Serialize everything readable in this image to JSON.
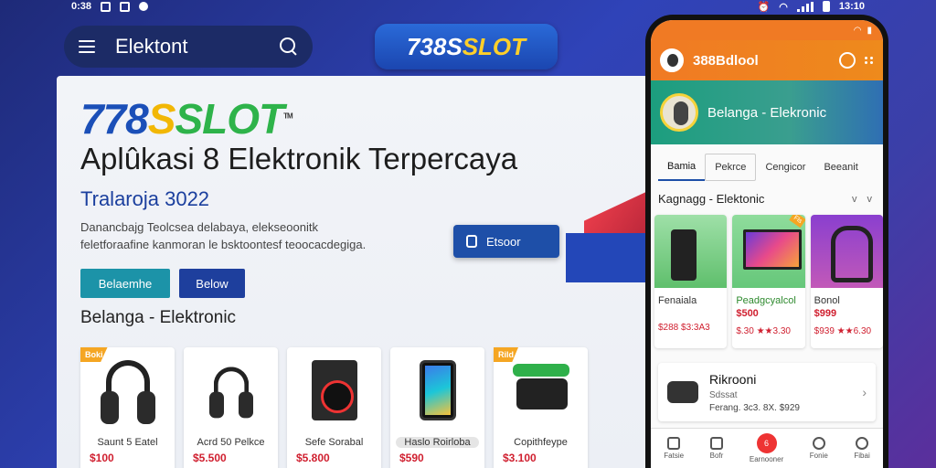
{
  "status_bar": {
    "time_left": "0:38",
    "time_right": "13:10"
  },
  "top_search": {
    "label": "Elektont"
  },
  "brand_pill": {
    "prefix": "738S",
    "highlight": "SLOT"
  },
  "main": {
    "logo": {
      "part1": "778",
      "part2": "S",
      "part3": "SLOT",
      "mark": "TM"
    },
    "headline": "Aplûkasi 8 Elektronik Terpercaya",
    "subhead": "Tralaroja 3022",
    "description": "Danancbajg Teolcsea delabaya, elekseoonitk feletforaafine kanmoran le bsktoontesf teoocacdegiga.",
    "buttons": {
      "primary": "Belaemhe",
      "secondary": "Below"
    },
    "section_title": "Belanga - Elektronic",
    "floating_button": "Etsoor",
    "products": [
      {
        "tag": "Boki",
        "name": "Saunt 5 Eatel",
        "price": "$100",
        "art": "headphone"
      },
      {
        "tag": "",
        "name": "Acrd 50 Pelkce",
        "price": "$5.500",
        "art": "headphone"
      },
      {
        "tag": "",
        "name": "Sefe Sorabal",
        "price": "$5.800",
        "art": "washer"
      },
      {
        "tag": "",
        "name": "Haslo Roirloba",
        "price": "$590",
        "art": "phone"
      },
      {
        "tag": "Rild",
        "name": "Copithfeype",
        "price": "$3.100",
        "art": "camera"
      }
    ]
  },
  "phone": {
    "appbar_title": "388Bdlool",
    "hero_title": "Belanga - Elekronic",
    "tabs": [
      "Bamia",
      "Pekrce",
      "Cengicor",
      "Beeanit"
    ],
    "category_title": "Kagnagg - Elektonic",
    "category_chevrons": "v v",
    "products": [
      {
        "name": "Fenaiala",
        "price": "$288 $3:3A3",
        "price2": "",
        "img": "green"
      },
      {
        "name": "Peadgcyalcol",
        "price": "$500",
        "price2": "$.30 ★★3.30",
        "img": "green2",
        "ribbon": "Fls"
      },
      {
        "name": "Bonol",
        "price": "$999",
        "price2": "$939 ★★6.30",
        "img": "purple"
      }
    ],
    "list_item": {
      "title": "Rikrooni",
      "sub": "Sdssat",
      "sub2": "Ferang. 3c3. 8X. $929"
    },
    "nav": [
      "Fatsie",
      "Bofr",
      "Earnooner",
      "Fonie",
      "Fibai"
    ],
    "nav_badge": "6"
  }
}
